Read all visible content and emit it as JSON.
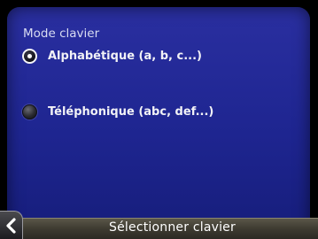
{
  "screen": {
    "section_title": "Mode clavier",
    "options": [
      {
        "label": "Alphabétique (a, b, c...)",
        "selected": true
      },
      {
        "label": "Téléphonique (abc, def...)",
        "selected": false
      }
    ]
  },
  "bottom_bar": {
    "title": "Sélectionner clavier",
    "back_icon": "chevron-left-icon"
  },
  "colors": {
    "screen_background": "#1e2590",
    "text": "#f2f2f6",
    "bar_background": "#3f3c32"
  }
}
